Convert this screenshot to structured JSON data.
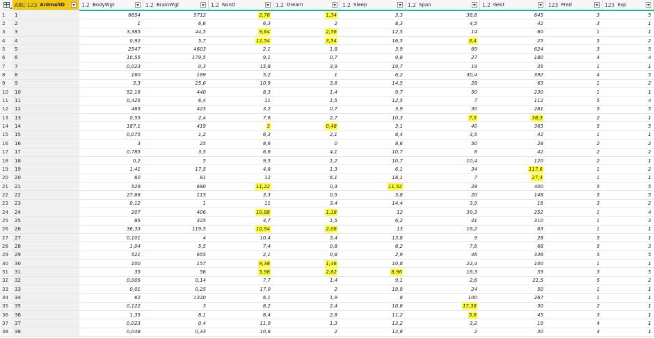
{
  "columns": [
    {
      "name": "AnimalID",
      "type_icon": "ABC-123",
      "selected": true
    },
    {
      "name": "BodyWgt",
      "type_icon": "1.2"
    },
    {
      "name": "BrainWgt",
      "type_icon": "1.2"
    },
    {
      "name": "NonD",
      "type_icon": "1.2"
    },
    {
      "name": "Dream",
      "type_icon": "1.2"
    },
    {
      "name": "Sleep",
      "type_icon": "1.2"
    },
    {
      "name": "Span",
      "type_icon": "1.2"
    },
    {
      "name": "Gest",
      "type_icon": "1.2"
    },
    {
      "name": "Pred",
      "type_icon": "123"
    },
    {
      "name": "Exp",
      "type_icon": "123"
    }
  ],
  "rows": [
    [
      "1",
      "1",
      "6654",
      "5712",
      "2,76",
      "1,34",
      "3,3",
      "38,6",
      "645",
      "3",
      "5"
    ],
    [
      "2",
      "2",
      "1",
      "6,6",
      "6,3",
      "2",
      "8,3",
      "4,5",
      "42",
      "3",
      "1"
    ],
    [
      "3",
      "3",
      "3,385",
      "44,5",
      "9,64",
      "2,56",
      "12,5",
      "14",
      "60",
      "1",
      "1"
    ],
    [
      "4",
      "4",
      "0,92",
      "5,7",
      "12,54",
      "3,54",
      "16,5",
      "3,4",
      "25",
      "5",
      "2"
    ],
    [
      "5",
      "5",
      "2547",
      "4603",
      "2,1",
      "1,8",
      "3,9",
      "69",
      "624",
      "3",
      "5"
    ],
    [
      "6",
      "6",
      "10,55",
      "179,5",
      "9,1",
      "0,7",
      "9,8",
      "27",
      "180",
      "4",
      "4"
    ],
    [
      "7",
      "7",
      "0,023",
      "0,3",
      "15,8",
      "3,9",
      "19,7",
      "19",
      "35",
      "1",
      "1"
    ],
    [
      "8",
      "8",
      "160",
      "169",
      "5,2",
      "1",
      "6,2",
      "30,4",
      "392",
      "4",
      "5"
    ],
    [
      "9",
      "9",
      "3,3",
      "25,6",
      "10,9",
      "3,6",
      "14,5",
      "28",
      "63",
      "1",
      "2"
    ],
    [
      "10",
      "10",
      "52,16",
      "440",
      "8,3",
      "1,4",
      "9,7",
      "50",
      "230",
      "1",
      "1"
    ],
    [
      "11",
      "11",
      "0,425",
      "6,4",
      "11",
      "1,5",
      "12,5",
      "7",
      "112",
      "5",
      "4"
    ],
    [
      "12",
      "12",
      "465",
      "423",
      "3,2",
      "0,7",
      "3,9",
      "30",
      "281",
      "5",
      "5"
    ],
    [
      "13",
      "13",
      "0,55",
      "2,4",
      "7,6",
      "2,7",
      "10,3",
      "7,5",
      "38,3",
      "2",
      "1"
    ],
    [
      "14",
      "14",
      "187,1",
      "419",
      "3",
      "0,48",
      "3,1",
      "40",
      "365",
      "5",
      "5"
    ],
    [
      "15",
      "15",
      "0,075",
      "1,2",
      "6,3",
      "2,1",
      "8,4",
      "3,5",
      "42",
      "1",
      "1"
    ],
    [
      "16",
      "16",
      "3",
      "25",
      "8,6",
      "0",
      "8,6",
      "50",
      "28",
      "2",
      "2"
    ],
    [
      "17",
      "17",
      "0,785",
      "3,5",
      "6,6",
      "4,1",
      "10,7",
      "6",
      "42",
      "2",
      "2"
    ],
    [
      "18",
      "18",
      "0,2",
      "5",
      "9,5",
      "1,2",
      "10,7",
      "10,4",
      "120",
      "2",
      "1"
    ],
    [
      "19",
      "19",
      "1,41",
      "17,5",
      "4,8",
      "1,3",
      "6,1",
      "34",
      "117,6",
      "1",
      "2"
    ],
    [
      "20",
      "20",
      "60",
      "81",
      "12",
      "6,1",
      "18,1",
      "7",
      "27,4",
      "1",
      "1"
    ],
    [
      "21",
      "21",
      "529",
      "680",
      "11,22",
      "0,3",
      "11,52",
      "28",
      "400",
      "5",
      "5"
    ],
    [
      "22",
      "22",
      "27,66",
      "115",
      "3,3",
      "0,5",
      "3,8",
      "20",
      "148",
      "5",
      "5"
    ],
    [
      "23",
      "23",
      "0,12",
      "1",
      "11",
      "3,4",
      "14,4",
      "3,9",
      "16",
      "3",
      "2"
    ],
    [
      "24",
      "24",
      "207",
      "406",
      "10,88",
      "1,18",
      "12",
      "39,3",
      "252",
      "1",
      "4"
    ],
    [
      "25",
      "25",
      "85",
      "325",
      "4,7",
      "1,5",
      "6,2",
      "41",
      "310",
      "1",
      "3"
    ],
    [
      "26",
      "26",
      "36,33",
      "119,5",
      "10,94",
      "2,08",
      "13",
      "16,2",
      "63",
      "1",
      "1"
    ],
    [
      "27",
      "27",
      "0,101",
      "4",
      "10,4",
      "3,4",
      "13,8",
      "9",
      "28",
      "5",
      "1"
    ],
    [
      "28",
      "28",
      "1,04",
      "5,5",
      "7,4",
      "0,8",
      "8,2",
      "7,6",
      "68",
      "5",
      "3"
    ],
    [
      "29",
      "29",
      "521",
      "655",
      "2,1",
      "0,8",
      "2,9",
      "46",
      "336",
      "5",
      "5"
    ],
    [
      "30",
      "30",
      "100",
      "157",
      "9,38",
      "1,46",
      "10,8",
      "22,4",
      "100",
      "1",
      "1"
    ],
    [
      "31",
      "31",
      "35",
      "56",
      "5,98",
      "2,62",
      "8,96",
      "16,3",
      "33",
      "3",
      "5"
    ],
    [
      "32",
      "32",
      "0,005",
      "0,14",
      "7,7",
      "1,4",
      "9,1",
      "2,6",
      "21,5",
      "5",
      "2"
    ],
    [
      "33",
      "33",
      "0,01",
      "0,25",
      "17,9",
      "2",
      "19,9",
      "24",
      "50",
      "1",
      "1"
    ],
    [
      "34",
      "34",
      "62",
      "1320",
      "6,1",
      "1,9",
      "8",
      "100",
      "267",
      "1",
      "1"
    ],
    [
      "35",
      "35",
      "0,122",
      "3",
      "8,2",
      "2,4",
      "10,6",
      "17,38",
      "30",
      "2",
      "1"
    ],
    [
      "36",
      "36",
      "1,35",
      "8,1",
      "8,4",
      "2,8",
      "11,2",
      "5,6",
      "45",
      "3",
      "1"
    ],
    [
      "37",
      "37",
      "0,023",
      "0,4",
      "11,9",
      "1,3",
      "13,2",
      "3,2",
      "19",
      "4",
      "1"
    ],
    [
      "38",
      "38",
      "0,048",
      "0,33",
      "10,8",
      "2",
      "12,8",
      "2",
      "30",
      "4",
      "1"
    ]
  ],
  "highlights": {
    "1": [
      4,
      5
    ],
    "3": [
      4,
      5
    ],
    "4": [
      4,
      5,
      7
    ],
    "13": [
      7,
      8
    ],
    "14": [
      4,
      5
    ],
    "19": [
      8
    ],
    "20": [
      8
    ],
    "21": [
      4,
      6
    ],
    "24": [
      4,
      5
    ],
    "26": [
      4,
      5
    ],
    "30": [
      4,
      5
    ],
    "31": [
      4,
      5,
      6
    ],
    "35": [
      7
    ],
    "36": [
      7
    ]
  },
  "colors": {
    "accent": "#1bb3a3",
    "selected_header": "#f2c811",
    "highlight": "#ffff33"
  },
  "icons": {
    "corner": "table-menu-icon",
    "dropdown": "chevron-down-icon"
  }
}
